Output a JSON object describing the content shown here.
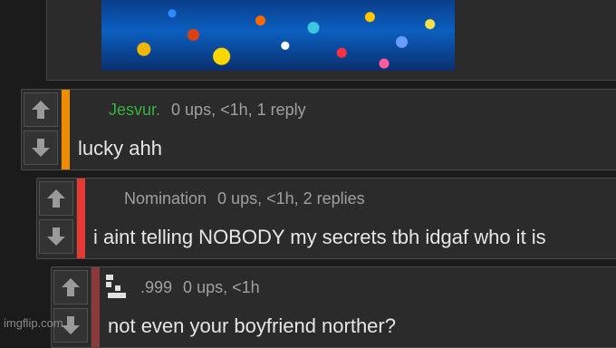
{
  "post": {
    "image_alt": "underwater coral reef with tropical fish"
  },
  "comments": [
    {
      "username": "Jesvur.",
      "meta": "0 ups, <1h, 1 reply",
      "text": "lucky ahh",
      "bar_color": "#f08c00",
      "name_color": "#38b23c"
    },
    {
      "username": "Nomination",
      "meta": "0 ups, <1h, 2 replies",
      "text": "i aint telling NOBODY my secrets tbh idgaf who it is",
      "bar_color": "#e53935",
      "name_color": "#a0a0a0"
    },
    {
      "username": ".999",
      "meta": "0 ups, <1h",
      "text": "not even your boyfriend norther?",
      "bar_color": "#8a3a3a",
      "name_color": "#a0a0a0"
    }
  ],
  "watermark": "imgflip.com"
}
